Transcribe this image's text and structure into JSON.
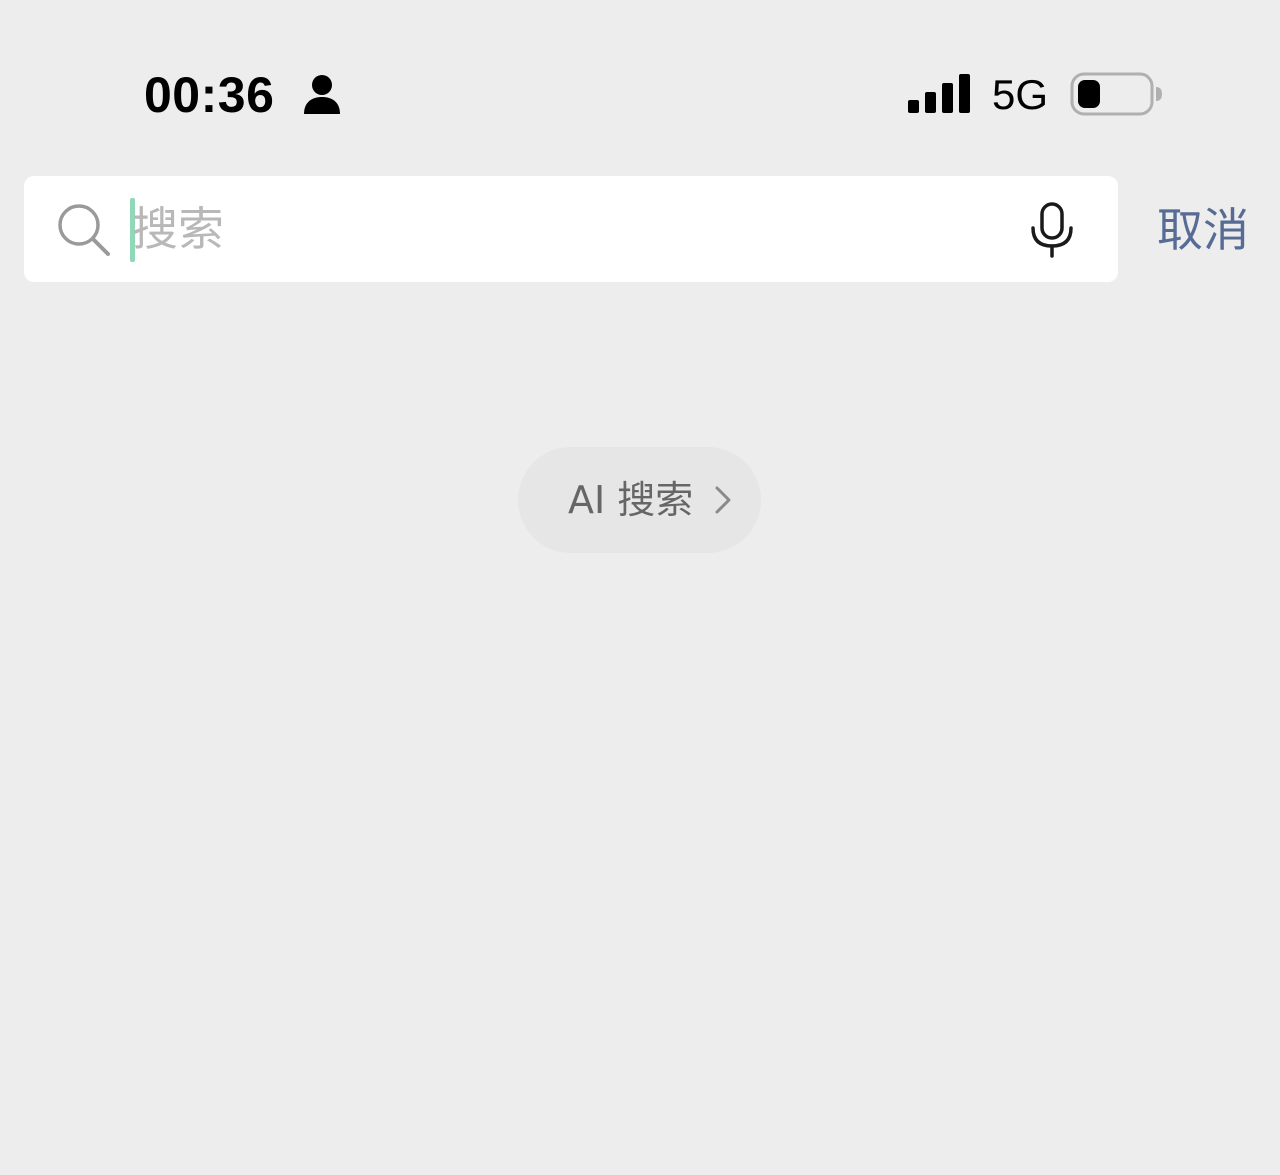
{
  "status_bar": {
    "time": "00:36",
    "network": "5G",
    "battery_level": 0.2,
    "signal_bars": 4,
    "icons": [
      "person-icon",
      "signal-icon",
      "battery-icon"
    ]
  },
  "search": {
    "placeholder": "搜索",
    "value": "",
    "cancel_label": "取消",
    "icons": [
      "search-icon",
      "microphone-icon"
    ]
  },
  "ai_search": {
    "label": "AI 搜索",
    "icon": "chevron-right-icon"
  },
  "colors": {
    "background": "#ededed",
    "cancel_link": "#576b95",
    "caret": "#8fd9b9",
    "placeholder": "#b8b8b8",
    "pill": "#e6e6e6"
  }
}
